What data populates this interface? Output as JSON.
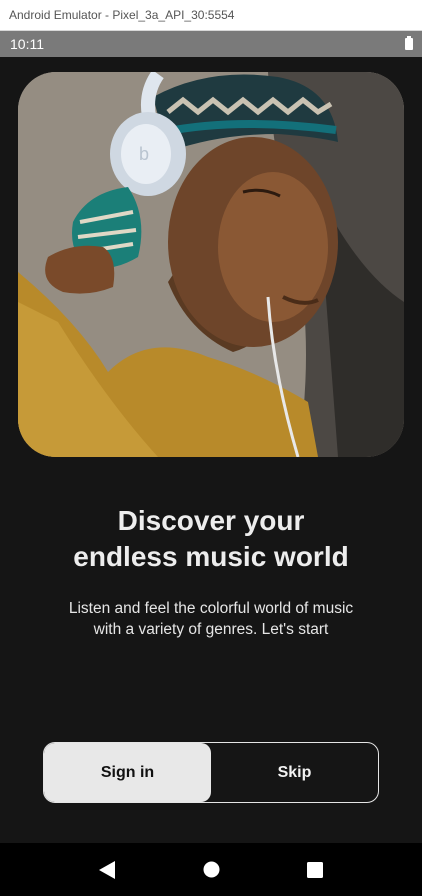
{
  "window": {
    "title": "Android Emulator - Pixel_3a_API_30:5554"
  },
  "status_bar": {
    "time": "10:11"
  },
  "onboarding": {
    "headline_line1": "Discover your",
    "headline_line2": "endless music world",
    "subtitle_line1": "Listen and feel the colorful world of music",
    "subtitle_line2": "with a variety of genres. Let's start",
    "sign_in_label": "Sign in",
    "skip_label": "Skip"
  },
  "colors": {
    "background": "#151515",
    "status_bar": "#7a7a7a",
    "primary_button": "#e8e8e8",
    "text": "#ededed"
  },
  "icons": [
    "battery-icon",
    "back-icon",
    "home-icon",
    "recents-icon"
  ]
}
